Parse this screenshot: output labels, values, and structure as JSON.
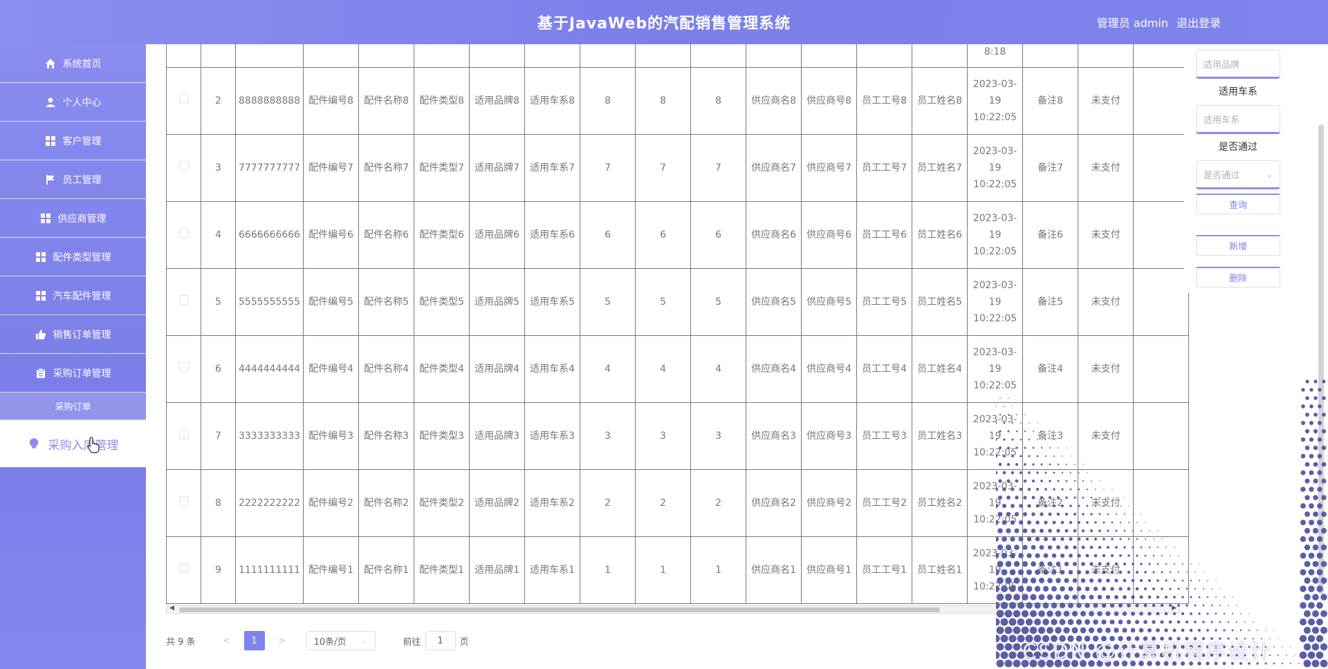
{
  "header": {
    "title": "基于JavaWeb的汽配销售管理系统",
    "user": "管理员 admin",
    "logout": "退出登录"
  },
  "sidebar": {
    "items": [
      {
        "label": "系统首页",
        "icon": "home-icon"
      },
      {
        "label": "个人中心",
        "icon": "user-icon"
      },
      {
        "label": "客户管理",
        "icon": "grid-icon"
      },
      {
        "label": "员工管理",
        "icon": "flag-icon"
      },
      {
        "label": "供应商管理",
        "icon": "grid-icon"
      },
      {
        "label": "配件类型管理",
        "icon": "grid-icon"
      },
      {
        "label": "汽车配件管理",
        "icon": "grid-icon"
      },
      {
        "label": "销售订单管理",
        "icon": "thumb-icon"
      },
      {
        "label": "采购订单管理",
        "icon": "clipboard-icon"
      }
    ],
    "submenu_title": "采购订单",
    "submenu_active": "采购入库管理"
  },
  "table": {
    "partial_row": {
      "c0": "",
      "c1": "",
      "c2": "...",
      "c3": "...",
      "c4": "...",
      "time_tail": "8:18"
    },
    "rows": [
      {
        "idx": "2",
        "order_no": "8888888888",
        "part_no": "配件编号8",
        "part_name": "配件名称8",
        "part_type": "配件类型8",
        "brand": "适用品牌8",
        "series": "适用车系8",
        "n1": "8",
        "n2": "8",
        "n3": "8",
        "supplier_name": "供应商名8",
        "supplier_no": "供应商号8",
        "emp_no": "员工工号8",
        "emp_name": "员工姓名8",
        "time": "2023-03-19 10:22:05",
        "note": "备注8",
        "pay": "未支付"
      },
      {
        "idx": "3",
        "order_no": "7777777777",
        "part_no": "配件编号7",
        "part_name": "配件名称7",
        "part_type": "配件类型7",
        "brand": "适用品牌7",
        "series": "适用车系7",
        "n1": "7",
        "n2": "7",
        "n3": "7",
        "supplier_name": "供应商名7",
        "supplier_no": "供应商号7",
        "emp_no": "员工工号7",
        "emp_name": "员工姓名7",
        "time": "2023-03-19 10:22:05",
        "note": "备注7",
        "pay": "未支付"
      },
      {
        "idx": "4",
        "order_no": "6666666666",
        "part_no": "配件编号6",
        "part_name": "配件名称6",
        "part_type": "配件类型6",
        "brand": "适用品牌6",
        "series": "适用车系6",
        "n1": "6",
        "n2": "6",
        "n3": "6",
        "supplier_name": "供应商名6",
        "supplier_no": "供应商号6",
        "emp_no": "员工工号6",
        "emp_name": "员工姓名6",
        "time": "2023-03-19 10:22:05",
        "note": "备注6",
        "pay": "未支付"
      },
      {
        "idx": "5",
        "order_no": "5555555555",
        "part_no": "配件编号5",
        "part_name": "配件名称5",
        "part_type": "配件类型5",
        "brand": "适用品牌5",
        "series": "适用车系5",
        "n1": "5",
        "n2": "5",
        "n3": "5",
        "supplier_name": "供应商名5",
        "supplier_no": "供应商号5",
        "emp_no": "员工工号5",
        "emp_name": "员工姓名5",
        "time": "2023-03-19 10:22:05",
        "note": "备注5",
        "pay": "未支付"
      },
      {
        "idx": "6",
        "order_no": "4444444444",
        "part_no": "配件编号4",
        "part_name": "配件名称4",
        "part_type": "配件类型4",
        "brand": "适用品牌4",
        "series": "适用车系4",
        "n1": "4",
        "n2": "4",
        "n3": "4",
        "supplier_name": "供应商名4",
        "supplier_no": "供应商号4",
        "emp_no": "员工工号4",
        "emp_name": "员工姓名4",
        "time": "2023-03-19 10:22:05",
        "note": "备注4",
        "pay": "未支付"
      },
      {
        "idx": "7",
        "order_no": "3333333333",
        "part_no": "配件编号3",
        "part_name": "配件名称3",
        "part_type": "配件类型3",
        "brand": "适用品牌3",
        "series": "适用车系3",
        "n1": "3",
        "n2": "3",
        "n3": "3",
        "supplier_name": "供应商名3",
        "supplier_no": "供应商号3",
        "emp_no": "员工工号3",
        "emp_name": "员工姓名3",
        "time": "2023-03-19 10:22:05",
        "note": "备注3",
        "pay": "未支付"
      },
      {
        "idx": "8",
        "order_no": "2222222222",
        "part_no": "配件编号2",
        "part_name": "配件名称2",
        "part_type": "配件类型2",
        "brand": "适用品牌2",
        "series": "适用车系2",
        "n1": "2",
        "n2": "2",
        "n3": "2",
        "supplier_name": "供应商名2",
        "supplier_no": "供应商号2",
        "emp_no": "员工工号2",
        "emp_name": "员工姓名2",
        "time": "2023-03-19 10:22:05",
        "note": "备注2",
        "pay": "未支付"
      },
      {
        "idx": "9",
        "order_no": "1111111111",
        "part_no": "配件编号1",
        "part_name": "配件名称1",
        "part_type": "配件类型1",
        "brand": "适用品牌1",
        "series": "适用车系1",
        "n1": "1",
        "n2": "1",
        "n3": "1",
        "supplier_name": "供应商名1",
        "supplier_no": "供应商号1",
        "emp_no": "员工工号1",
        "emp_name": "员工姓名1",
        "time": "2023-03-19 10:22:05",
        "note": "备注1",
        "pay": "未支付"
      }
    ]
  },
  "pagination": {
    "total": "共 9 条",
    "prev": "<",
    "current": "1",
    "next": ">",
    "page_size": "10条/页",
    "goto_label": "前往",
    "goto_value": "1",
    "goto_suffix": "页"
  },
  "filter": {
    "brand_placeholder": "适用品牌",
    "series_label": "适用车系",
    "series_placeholder": "适用车系",
    "pass_label": "是否通过",
    "pass_placeholder": "是否通过",
    "query_btn": "查询",
    "add_btn": "新增",
    "delete_btn": "删除"
  },
  "watermark": "CSDN @计算机程序设计",
  "colors": {
    "accent": "#7f83ec",
    "sidebar": "#8a8cf0"
  }
}
